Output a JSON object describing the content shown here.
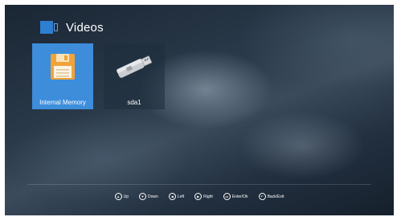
{
  "header": {
    "title": "Videos",
    "icon": "video-icon",
    "accent": "#2f7fd0"
  },
  "tiles": [
    {
      "label": "Internal Memory",
      "icon": "floppy-disk-icon",
      "selected": true
    },
    {
      "label": "sda1",
      "icon": "usb-drive-icon",
      "selected": false
    }
  ],
  "hints": [
    {
      "label": "Up",
      "icon": "up-icon",
      "glyph": "▲"
    },
    {
      "label": "Down",
      "icon": "down-icon",
      "glyph": "▼"
    },
    {
      "label": "Left",
      "icon": "left-icon",
      "glyph": "◀"
    },
    {
      "label": "Right",
      "icon": "right-icon",
      "glyph": "▶"
    },
    {
      "label": "Enter/Ok",
      "icon": "ok-icon",
      "glyph": "ok"
    },
    {
      "label": "Back/Exit",
      "icon": "back-icon",
      "glyph": "↶"
    }
  ],
  "colors": {
    "tile_selected": "#3d8ddb",
    "floppy": "#f1a33a"
  }
}
